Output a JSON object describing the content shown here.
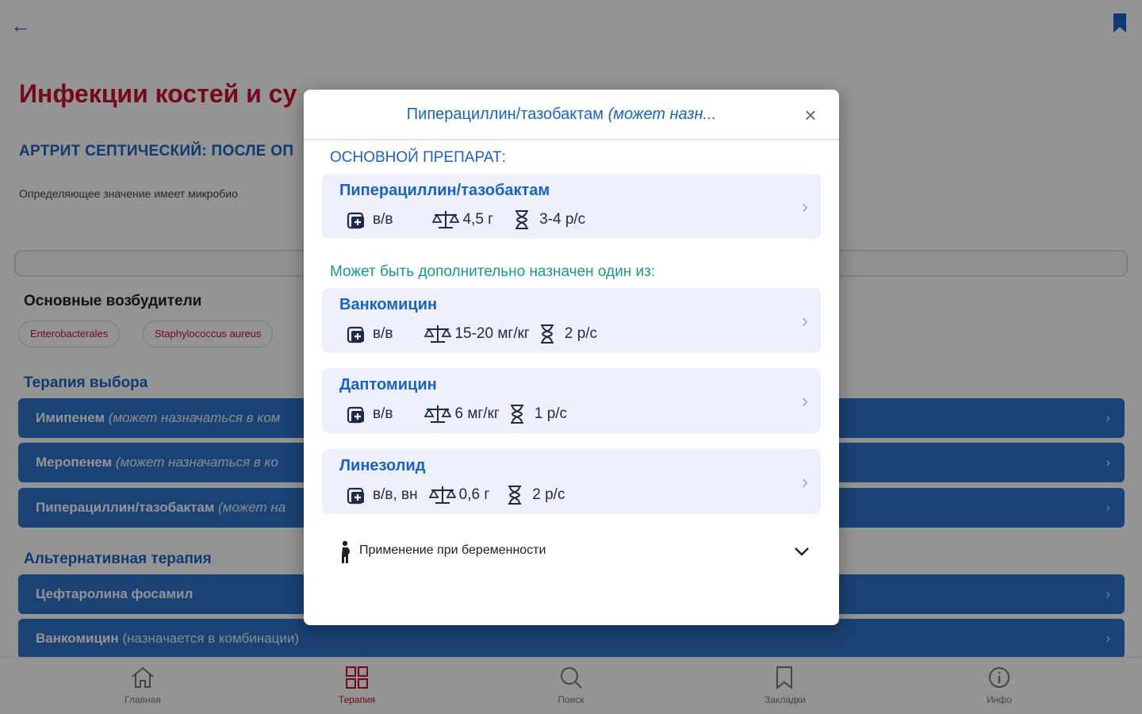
{
  "topbar": {
    "back_icon": "arrow-left-icon",
    "bookmark_icon": "bookmark-icon"
  },
  "page": {
    "title": "Инфекции костей и су",
    "subtitle": "АРТРИТ СЕПТИЧЕСКИЙ: ПОСЛЕ ОП",
    "description": "Определяющее значение имеет микробио",
    "pathogens_title": "Основные возбудители",
    "pathogens": [
      "Enterobacterales",
      "Staphylococcus aureus"
    ],
    "therapy_title": "Терапия выбора",
    "therapy": [
      {
        "name": "Имипенем",
        "note": "(может назначаться в ком"
      },
      {
        "name": "Меропенем",
        "note": "(может назначаться в ко"
      },
      {
        "name": "Пиперациллин/тазобактам",
        "note": "(может на"
      }
    ],
    "alt_title": "Альтернативная терапия",
    "alternative": [
      {
        "name": "Цефтаролина фосамил",
        "note": ""
      },
      {
        "name": "Ванкомицин",
        "note": "(назначается в комбинации)"
      }
    ]
  },
  "bottom_nav": [
    {
      "label": "Главная",
      "icon": "home-icon"
    },
    {
      "label": "Терапия",
      "icon": "grid-icon",
      "active": true
    },
    {
      "label": "Поиск",
      "icon": "search-icon"
    },
    {
      "label": "Закладки",
      "icon": "bookmark-icon"
    },
    {
      "label": "Инфо",
      "icon": "info-icon"
    }
  ],
  "modal": {
    "title_main": "Пиперациллин/тазобактам",
    "title_note": "(может назн...",
    "close_icon": "close-icon",
    "main_section_label": "ОСНОВНОЙ ПРЕПАРАТ:",
    "main_drug": {
      "name": "Пиперациллин/тазобактам",
      "route": "в/в",
      "dose": "4,5 г",
      "frequency": "3-4 р/с"
    },
    "additional_label": "Может быть дополнительно назначен один из:",
    "additional_drugs": [
      {
        "name": "Ванкомицин",
        "route": "в/в",
        "dose": "15-20 мг/кг",
        "frequency": "2 р/с"
      },
      {
        "name": "Даптомицин",
        "route": "в/в",
        "dose": "6 мг/кг",
        "frequency": "1 р/с"
      },
      {
        "name": "Линезолид",
        "route": "в/в, вн",
        "dose": "0,6 г",
        "frequency": "2 р/с"
      }
    ],
    "pregnancy_label": "Применение при беременности",
    "icons": {
      "route": "iv-drip-icon",
      "dose": "scales-icon",
      "frequency": "hourglass-icon",
      "pregnancy": "pregnant-woman-icon",
      "expand": "chevron-down-icon"
    }
  },
  "colors": {
    "accent": "#1a63c4",
    "title_red": "#c8102e",
    "teal": "#169a88",
    "bar_blue": "#2f73c8",
    "card_bg": "#eef1fb"
  }
}
